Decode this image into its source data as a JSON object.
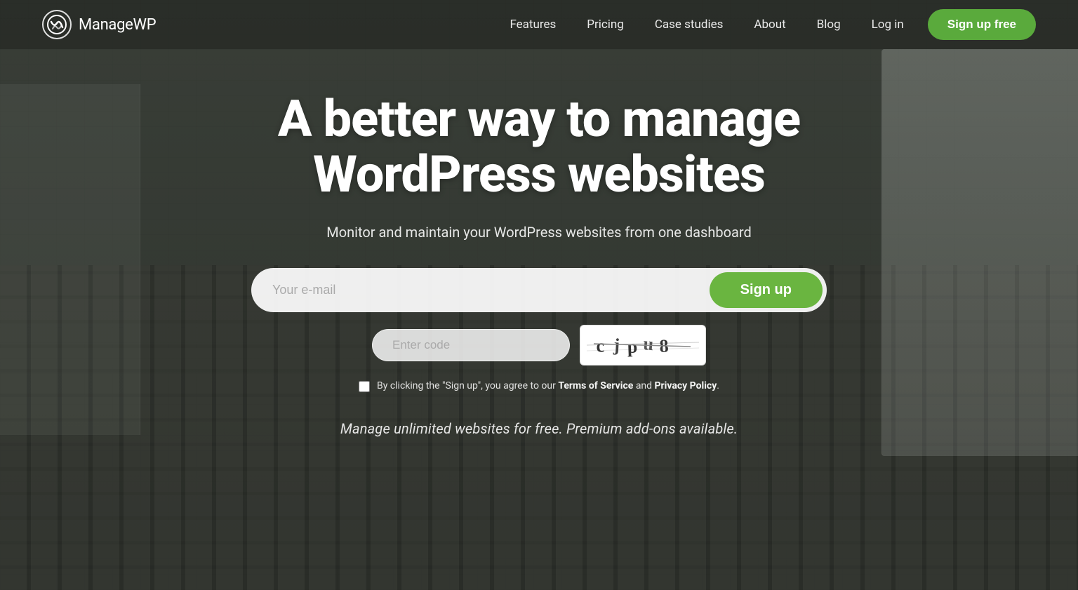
{
  "logo": {
    "name": "ManageWP",
    "part1": "Manage",
    "part2": "WP"
  },
  "nav": {
    "links": [
      {
        "label": "Features",
        "id": "features"
      },
      {
        "label": "Pricing",
        "id": "pricing"
      },
      {
        "label": "Case studies",
        "id": "case-studies"
      },
      {
        "label": "About",
        "id": "about"
      },
      {
        "label": "Blog",
        "id": "blog"
      },
      {
        "label": "Log in",
        "id": "login"
      }
    ],
    "signup_btn": "Sign up free"
  },
  "hero": {
    "title": "A better way to manage WordPress websites",
    "subtitle": "Monitor and maintain your WordPress websites from one dashboard"
  },
  "form": {
    "email_placeholder": "Your e-mail",
    "signup_btn": "Sign up",
    "captcha_placeholder": "Enter code"
  },
  "terms": {
    "text": "By clicking the \"Sign up\", you agree to our ",
    "tos": "Terms of Service",
    "and": " and ",
    "privacy": "Privacy Policy",
    "period": "."
  },
  "tagline": {
    "text": "Manage unlimited websites for free. Premium add-ons available."
  }
}
